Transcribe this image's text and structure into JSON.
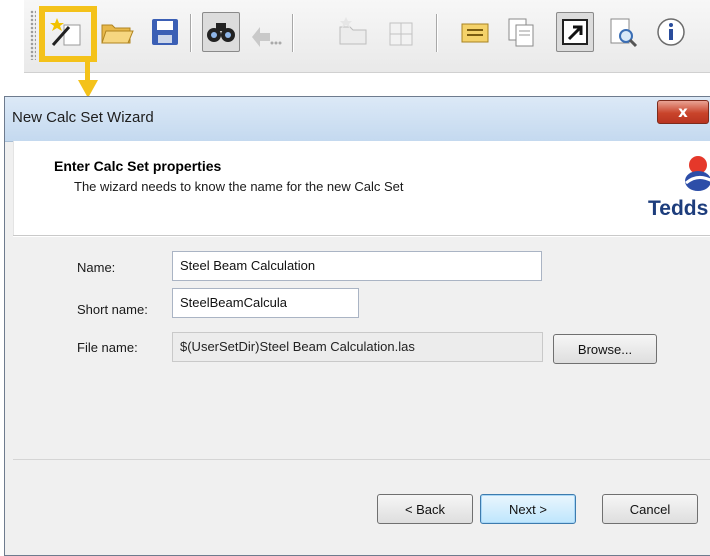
{
  "toolbar": {
    "buttons": [
      {
        "name": "new-calc-set-wizard-icon"
      },
      {
        "name": "open-folder-icon"
      },
      {
        "name": "save-icon"
      },
      {
        "name": "find-icon"
      },
      {
        "name": "go-to-icon"
      },
      {
        "name": "new-folder-icon"
      },
      {
        "name": "new-calc-icon"
      },
      {
        "name": "properties-icon"
      },
      {
        "name": "copy-icon"
      },
      {
        "name": "shortcut-icon"
      },
      {
        "name": "print-preview-icon"
      },
      {
        "name": "info-icon"
      }
    ],
    "highlight_color": "#f4c21a"
  },
  "dialog": {
    "title": "New Calc Set Wizard",
    "close_glyph": "x",
    "header": {
      "title": "Enter Calc Set properties",
      "subtitle": "The wizard needs to know the name for the new Calc Set",
      "logo_text": "Tedds"
    },
    "form": {
      "name_label": "Name:",
      "name_value": "Steel Beam Calculation",
      "short_name_label": "Short name:",
      "short_name_value": "SteelBeamCalcula",
      "file_name_label": "File name:",
      "file_name_value": "$(UserSetDir)Steel Beam Calculation.las",
      "browse_label": "Browse..."
    },
    "buttons": {
      "back": "< Back",
      "next": "Next >",
      "cancel": "Cancel"
    }
  }
}
